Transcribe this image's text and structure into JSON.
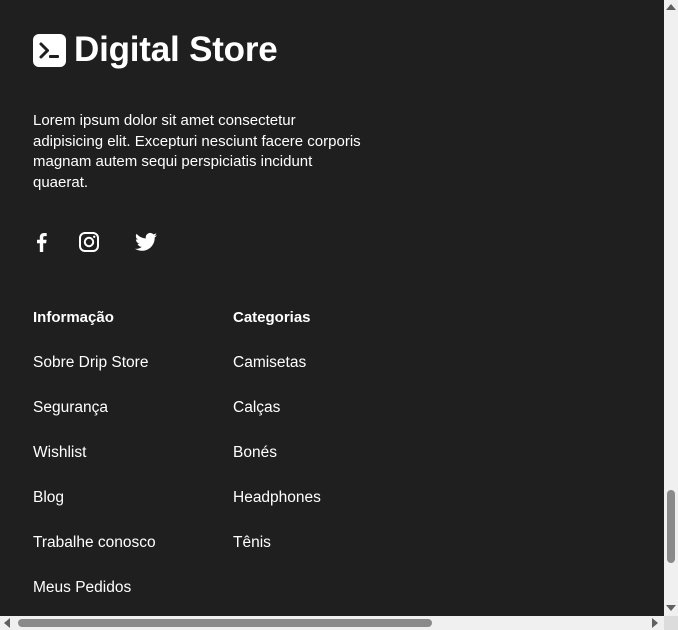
{
  "brand": {
    "name": "Digital Store"
  },
  "description": "Lorem ipsum dolor sit amet consectetur adipisicing elit. Excepturi nesciunt facere corporis magnam autem sequi perspiciatis incidunt quaerat.",
  "social": [
    "facebook-icon",
    "instagram-icon",
    "twitter-icon"
  ],
  "info": {
    "title": "Informação",
    "links": [
      "Sobre Drip Store",
      "Segurança",
      "Wishlist",
      "Blog",
      "Trabalhe conosco",
      "Meus Pedidos"
    ]
  },
  "categories": {
    "title": "Categorias",
    "links": [
      "Camisetas",
      "Calças",
      "Bonés",
      "Headphones",
      "Tênis"
    ]
  },
  "colors": {
    "background": "#1f1f1f",
    "text": "#ffffff",
    "scrollbar": "#f0f0f0",
    "thumb": "#8a8a8a"
  }
}
